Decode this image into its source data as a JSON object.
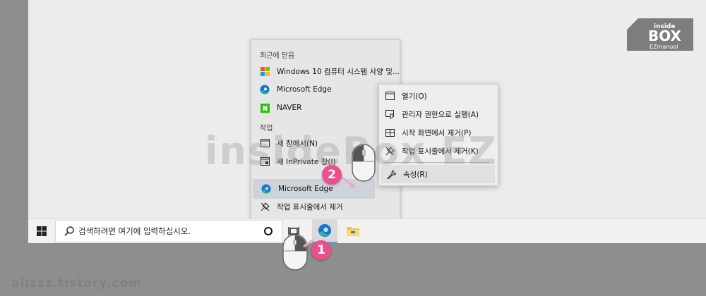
{
  "jump_list": {
    "recent_heading": "최근에 닫음",
    "recent_items": [
      {
        "label": "Windows 10 컴퓨터 시스템 사양 및...",
        "icon": "windows-logo-icon"
      },
      {
        "label": "Microsoft Edge",
        "icon": "edge-icon"
      },
      {
        "label": "NAVER",
        "icon": "naver-icon"
      }
    ],
    "tasks_heading": "작업",
    "task_items": [
      {
        "label": "새 창에서(N)",
        "icon": "window-icon"
      },
      {
        "label": "새 InPrivate 창(I)",
        "icon": "inprivate-icon"
      }
    ],
    "app_item": {
      "label": "Microsoft Edge",
      "icon": "edge-icon"
    },
    "unpin_item": {
      "label": "작업 표시줄에서 제거",
      "icon": "unpin-icon"
    }
  },
  "context_menu": {
    "items": [
      {
        "label": "열기(O)",
        "icon": "window-icon"
      },
      {
        "label": "관리자 권한으로 실행(A)",
        "icon": "shield-window-icon"
      },
      {
        "label": "시작 화면에서 제거(P)",
        "icon": "tiles-icon"
      },
      {
        "label": "작업 표시줄에서 제거(K)",
        "icon": "unpin-icon"
      }
    ],
    "properties": {
      "label": "속성(R)",
      "icon": "wrench-icon"
    }
  },
  "taskbar": {
    "search_placeholder": "검색하려면 여기에 입력하십시오.",
    "buttons": [
      "start-icon",
      "cortana-icon",
      "task-view-icon",
      "edge-icon",
      "file-explorer-icon"
    ]
  },
  "annotations": {
    "step1": "1",
    "step2": "2"
  },
  "logo": {
    "line1": "inside",
    "line2": "BOX",
    "line3": "EZmanual"
  },
  "watermark_text": "insideBox EZmanual",
  "footer_watermark": "alizzz.tistory.com",
  "colors": {
    "badge": "#ea4f8e",
    "edge_blue": "#0f78d4",
    "edge_green": "#35c186",
    "naver_green": "#1ec800",
    "taskbar": "#f1f1f1"
  }
}
